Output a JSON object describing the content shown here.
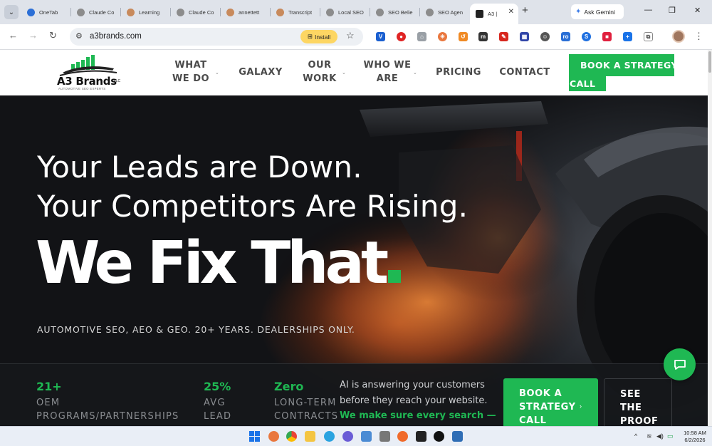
{
  "browser": {
    "tabs": [
      {
        "label": "OneTab",
        "color": "#2c6fd6"
      },
      {
        "label": "Claude Co",
        "color": "#777777"
      },
      {
        "label": "Learning",
        "color": "#b86b3a"
      },
      {
        "label": "Claude Co",
        "color": "#777777"
      },
      {
        "label": "annettett",
        "color": "#b86b3a"
      },
      {
        "label": "Transcript",
        "color": "#b86b3a"
      },
      {
        "label": "Local SEO",
        "color": "#777777"
      },
      {
        "label": "SEO Belie",
        "color": "#777777"
      },
      {
        "label": "SEO Agen",
        "color": "#777777"
      },
      {
        "label": "A3 |",
        "color": "#222222",
        "active": true
      }
    ],
    "new_tab": "+",
    "ask_gemini": "Ask Gemini",
    "url": "a3brands.com",
    "install": "Install",
    "window_controls": {
      "minimize": "—",
      "restore": "❐",
      "close": "✕"
    }
  },
  "site": {
    "logo": {
      "brand": "A3 Brands",
      "sub": "AUTOMOTIVE SEO EXPERTS",
      "badge": "LLC"
    },
    "nav": [
      {
        "label": "WHAT WE DO",
        "lines": [
          "WHAT",
          "WE DO"
        ],
        "has_dropdown": true
      },
      {
        "label": "GALAXY",
        "lines": [
          "GALAXY"
        ],
        "has_dropdown": false
      },
      {
        "label": "OUR WORK",
        "lines": [
          "OUR",
          "WORK"
        ],
        "has_dropdown": true
      },
      {
        "label": "WHO WE ARE",
        "lines": [
          "WHO WE",
          "ARE"
        ],
        "has_dropdown": true
      },
      {
        "label": "PRICING",
        "lines": [
          "PRICING"
        ],
        "has_dropdown": false
      },
      {
        "label": "CONTACT",
        "lines": [
          "CONTACT"
        ],
        "has_dropdown": false
      }
    ],
    "header_cta": {
      "line1": "BOOK A STRATEGY",
      "line2": "CALL"
    },
    "hero": {
      "line1": "Your Leads are Down.",
      "line2": "Your Competitors Are Rising.",
      "headline": "We Fix That",
      "tagline": "AUTOMOTIVE SEO, AEO & GEO. 20+ YEARS. DEALERSHIPS ONLY."
    },
    "stats": [
      {
        "value": "21+",
        "label_lines": [
          "OEM",
          "PROGRAMS/PARTNERSHIPS"
        ]
      },
      {
        "value": "25%",
        "label_lines": [
          "AVG",
          "LEAD"
        ]
      },
      {
        "value": "Zero",
        "label_lines": [
          "LONG-TERM",
          "CONTRACTS"
        ]
      }
    ],
    "ai_copy": {
      "plain": "AI is answering your customers before they reach your website.",
      "green": "We make sure every search — Google"
    },
    "cta_main": {
      "lines": [
        "BOOK A",
        "STRATEGY",
        "CALL"
      ],
      "arrow": "›"
    },
    "see_proof": {
      "lines": [
        "SEE",
        "THE",
        "PROOF"
      ]
    },
    "colors": {
      "accent": "#1fb853",
      "hero_bg": "#111214",
      "nav_text": "#4a4a4a"
    }
  },
  "taskbar": {
    "time": "10:58 AM",
    "date": "6/2/2026",
    "tray_chevron": "^"
  }
}
